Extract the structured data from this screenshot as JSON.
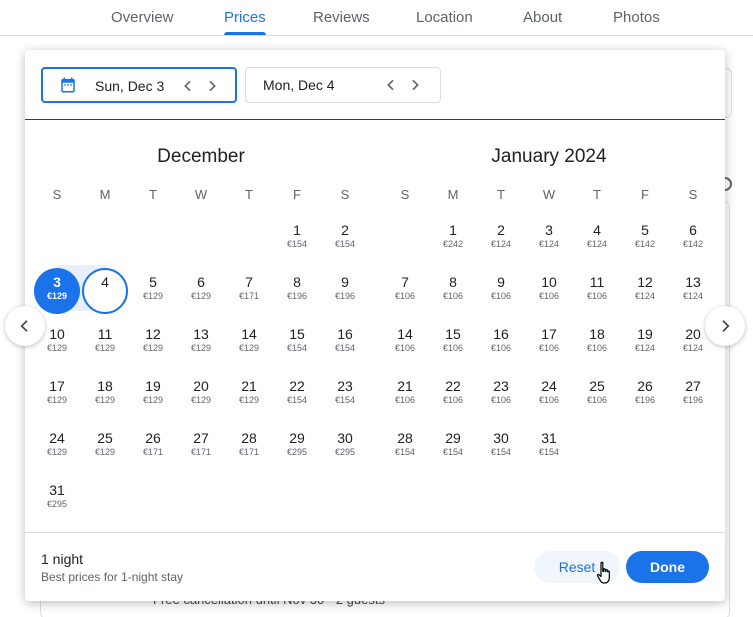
{
  "tabs": [
    "Overview",
    "Prices",
    "Reviews",
    "Location",
    "About",
    "Photos"
  ],
  "active_tab": "Prices",
  "background_footer": "Free cancellation until Nov 30 · 2 guests",
  "checkin": {
    "label": "Sun, Dec 3",
    "icon": "calendar-icon"
  },
  "checkout": {
    "label": "Mon, Dec 4"
  },
  "weekdays": [
    "S",
    "M",
    "T",
    "W",
    "T",
    "F",
    "S"
  ],
  "months": [
    {
      "title": "December",
      "rows": [
        [
          null,
          null,
          null,
          null,
          null,
          {
            "d": "1",
            "p": "€154"
          },
          {
            "d": "2",
            "p": "€154"
          }
        ],
        [
          {
            "d": "3",
            "p": "€129"
          },
          {
            "d": "4",
            "p": ""
          },
          {
            "d": "5",
            "p": "€129"
          },
          {
            "d": "6",
            "p": "€129"
          },
          {
            "d": "7",
            "p": "€171"
          },
          {
            "d": "8",
            "p": "€196"
          },
          {
            "d": "9",
            "p": "€196"
          }
        ],
        [
          {
            "d": "10",
            "p": "€129"
          },
          {
            "d": "11",
            "p": "€129"
          },
          {
            "d": "12",
            "p": "€129"
          },
          {
            "d": "13",
            "p": "€129"
          },
          {
            "d": "14",
            "p": "€129"
          },
          {
            "d": "15",
            "p": "€154"
          },
          {
            "d": "16",
            "p": "€154"
          }
        ],
        [
          {
            "d": "17",
            "p": "€129"
          },
          {
            "d": "18",
            "p": "€129"
          },
          {
            "d": "19",
            "p": "€129"
          },
          {
            "d": "20",
            "p": "€129"
          },
          {
            "d": "21",
            "p": "€129"
          },
          {
            "d": "22",
            "p": "€154"
          },
          {
            "d": "23",
            "p": "€154"
          }
        ],
        [
          {
            "d": "24",
            "p": "€129"
          },
          {
            "d": "25",
            "p": "€129"
          },
          {
            "d": "26",
            "p": "€171"
          },
          {
            "d": "27",
            "p": "€171"
          },
          {
            "d": "28",
            "p": "€171"
          },
          {
            "d": "29",
            "p": "€295"
          },
          {
            "d": "30",
            "p": "€295"
          }
        ],
        [
          {
            "d": "31",
            "p": "€295"
          },
          null,
          null,
          null,
          null,
          null,
          null
        ]
      ]
    },
    {
      "title": "January 2024",
      "rows": [
        [
          null,
          {
            "d": "1",
            "p": "€242"
          },
          {
            "d": "2",
            "p": "€124"
          },
          {
            "d": "3",
            "p": "€124"
          },
          {
            "d": "4",
            "p": "€124"
          },
          {
            "d": "5",
            "p": "€142"
          },
          {
            "d": "6",
            "p": "€142"
          }
        ],
        [
          {
            "d": "7",
            "p": "€106"
          },
          {
            "d": "8",
            "p": "€106"
          },
          {
            "d": "9",
            "p": "€106"
          },
          {
            "d": "10",
            "p": "€106"
          },
          {
            "d": "11",
            "p": "€106"
          },
          {
            "d": "12",
            "p": "€124"
          },
          {
            "d": "13",
            "p": "€124"
          }
        ],
        [
          {
            "d": "14",
            "p": "€106"
          },
          {
            "d": "15",
            "p": "€106"
          },
          {
            "d": "16",
            "p": "€106"
          },
          {
            "d": "17",
            "p": "€106"
          },
          {
            "d": "18",
            "p": "€106"
          },
          {
            "d": "19",
            "p": "€124"
          },
          {
            "d": "20",
            "p": "€124"
          }
        ],
        [
          {
            "d": "21",
            "p": "€106"
          },
          {
            "d": "22",
            "p": "€106"
          },
          {
            "d": "23",
            "p": "€106"
          },
          {
            "d": "24",
            "p": "€106"
          },
          {
            "d": "25",
            "p": "€106"
          },
          {
            "d": "26",
            "p": "€196"
          },
          {
            "d": "27",
            "p": "€196"
          }
        ],
        [
          {
            "d": "28",
            "p": "€154"
          },
          {
            "d": "29",
            "p": "€154"
          },
          {
            "d": "30",
            "p": "€154"
          },
          {
            "d": "31",
            "p": "€154"
          },
          null,
          null,
          null
        ]
      ]
    }
  ],
  "footer": {
    "nights": "1 night",
    "subtitle": "Best prices for 1-night stay",
    "reset_label": "Reset",
    "done_label": "Done"
  },
  "colors": {
    "accent": "#1a73e8",
    "range_fill": "#e8f0fe",
    "reset_bg": "#f1f5fc"
  }
}
